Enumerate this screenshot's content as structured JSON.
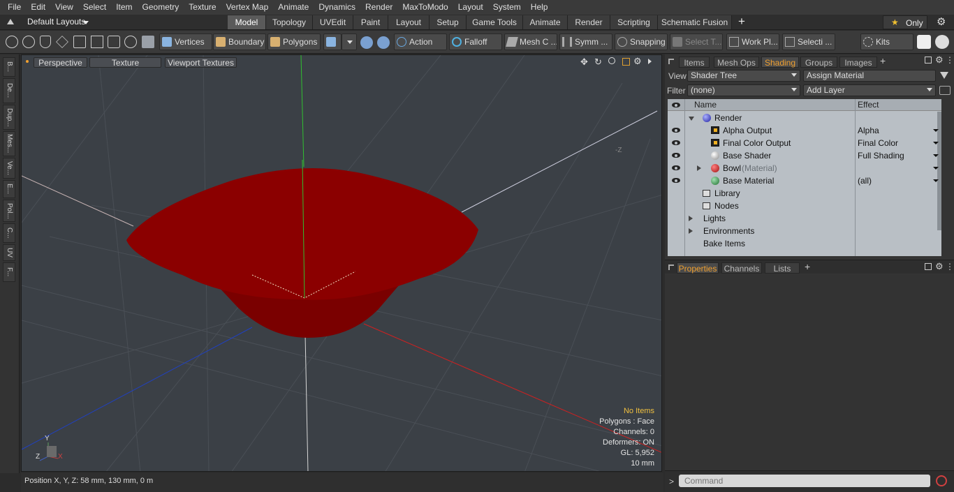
{
  "menu": [
    "File",
    "Edit",
    "View",
    "Select",
    "Item",
    "Geometry",
    "Texture",
    "Vertex Map",
    "Animate",
    "Dynamics",
    "Render",
    "MaxToModo",
    "Layout",
    "System",
    "Help"
  ],
  "layout_selector": "Default Layouts",
  "layout_tabs": [
    "Model",
    "Topology",
    "UVEdit",
    "Paint",
    "Layout",
    "Setup",
    "Game Tools",
    "Animate",
    "Render",
    "Scripting",
    "Schematic Fusion"
  ],
  "only_label": "Only",
  "toolbar": {
    "vertices": "Vertices",
    "boundary": "Boundary",
    "polygons": "Polygons",
    "action": "Action",
    "falloff": "Falloff",
    "mesh": "Mesh C ...",
    "symm": "Symm ...",
    "snapping": "Snapping",
    "select_t": "Select T...",
    "work_plane": "Work Pl...",
    "selection": "Selecti ...",
    "kits": "Kits"
  },
  "left_tabs": [
    "B...",
    "De...",
    "Dup...",
    "Mes...",
    "Ve...",
    "E...",
    "Pol...",
    "C...",
    "UV",
    "F..."
  ],
  "viewport": {
    "perspective": "Perspective",
    "texture": "Texture",
    "viewport_textures": "Viewport Textures",
    "info": {
      "no_items": "No Items",
      "polygons": "Polygons : Face",
      "channels": "Channels: 0",
      "deformers": "Deformers: ON",
      "gl": "GL: 5,952",
      "scale": "10 mm"
    },
    "axis_y": "Y",
    "axis_z": "Z",
    "axis_x": "X",
    "axis_neg_z": "-Z"
  },
  "status": "Position X, Y, Z:  58 mm, 130 mm, 0 m",
  "right_tabs": [
    "Items",
    "Mesh Ops",
    "Shading",
    "Groups",
    "Images"
  ],
  "view_label": "View",
  "view_value": "Shader Tree",
  "assign_material": "Assign Material",
  "filter_label": "Filter",
  "filter_value": "(none)",
  "add_layer": "Add Layer",
  "tree_headers": {
    "name": "Name",
    "effect": "Effect"
  },
  "tree": {
    "render": "Render",
    "alpha": "Alpha Output",
    "alpha_eff": "Alpha",
    "final": "Final Color Output",
    "final_eff": "Final Color",
    "base_shader": "Base Shader",
    "base_shader_eff": "Full Shading",
    "bowl": "Bowl",
    "bowl_sub": "(Material)",
    "base_material": "Base Material",
    "base_material_eff": "(all)",
    "library": "Library",
    "nodes": "Nodes",
    "lights": "Lights",
    "environments": "Environments",
    "bake": "Bake Items"
  },
  "bottom_tabs": [
    "Properties",
    "Channels",
    "Lists"
  ],
  "command_placeholder": "Command",
  "colors": {
    "bowl": "#8b0000",
    "accent": "#f0a030"
  }
}
